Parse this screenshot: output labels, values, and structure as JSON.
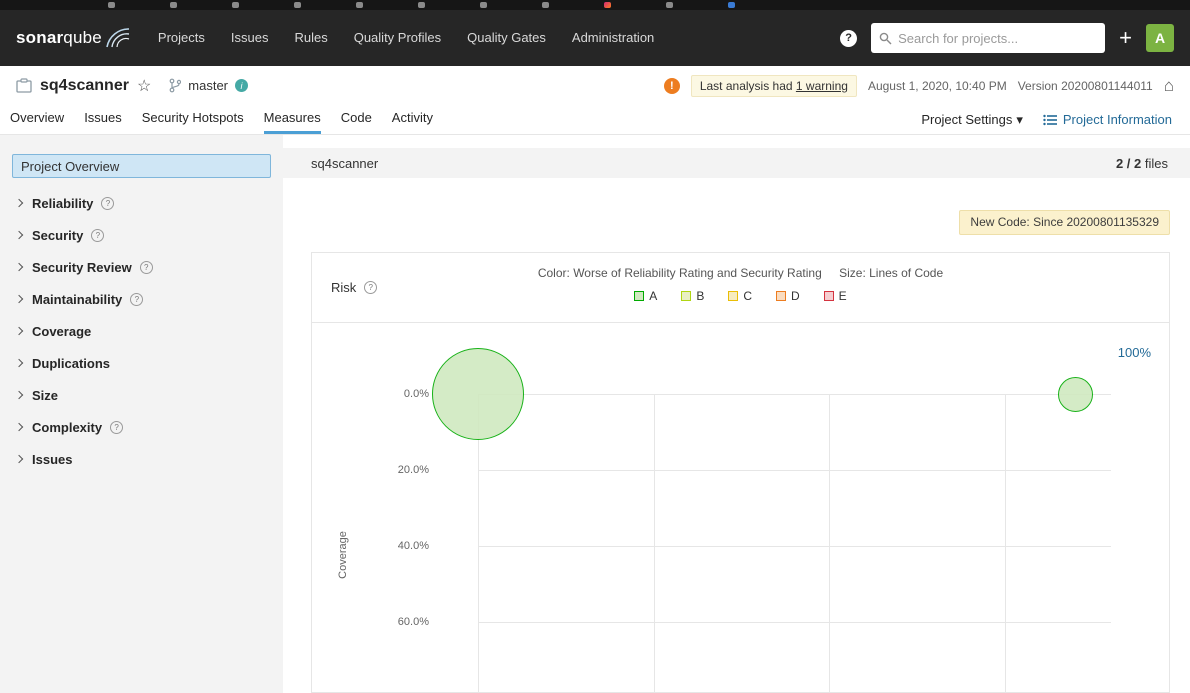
{
  "icons": {
    "help": "?",
    "plus": "+",
    "star": "☆",
    "home": "⌂",
    "caret_down": "▾",
    "warning": "!",
    "info": "i"
  },
  "navbar": {
    "logo_primary": "sonar",
    "logo_secondary": "qube",
    "items": [
      "Projects",
      "Issues",
      "Rules",
      "Quality Profiles",
      "Quality Gates",
      "Administration"
    ],
    "search_placeholder": "Search for projects...",
    "avatar_initial": "A"
  },
  "project_header": {
    "name": "sq4scanner",
    "branch": "master",
    "warning_prefix": "Last analysis had",
    "warning_link": "1 warning",
    "analysis_date": "August 1, 2020, 10:40 PM",
    "version": "Version 20200801144011"
  },
  "tabs": {
    "items": [
      "Overview",
      "Issues",
      "Security Hotspots",
      "Measures",
      "Code",
      "Activity"
    ],
    "active": "Measures",
    "project_settings": "Project Settings",
    "project_information": "Project Information"
  },
  "sidebar": {
    "selected": "Project Overview",
    "items": [
      {
        "label": "Reliability",
        "help": true
      },
      {
        "label": "Security",
        "help": true
      },
      {
        "label": "Security Review",
        "help": true
      },
      {
        "label": "Maintainability",
        "help": true
      },
      {
        "label": "Coverage",
        "help": false
      },
      {
        "label": "Duplications",
        "help": false
      },
      {
        "label": "Size",
        "help": false
      },
      {
        "label": "Complexity",
        "help": true
      },
      {
        "label": "Issues",
        "help": false
      }
    ]
  },
  "main": {
    "breadcrumb": "sq4scanner",
    "files_count": "2 / 2",
    "files_label": "files",
    "new_code_badge": "New Code: Since 20200801135329"
  },
  "chart_data": {
    "type": "bubble",
    "title": "Risk",
    "legend_color": "Color: Worse of Reliability Rating and Security Rating",
    "legend_size": "Size: Lines of Code",
    "ratings": [
      {
        "label": "A",
        "border": "#00aa00",
        "fill": "#d0e9c0"
      },
      {
        "label": "B",
        "border": "#b0d513",
        "fill": "#e9f0c3"
      },
      {
        "label": "C",
        "border": "#eabe06",
        "fill": "#f7ecc0"
      },
      {
        "label": "D",
        "border": "#ed7d20",
        "fill": "#fadcc0"
      },
      {
        "label": "E",
        "border": "#d4333f",
        "fill": "#f6cdd0"
      }
    ],
    "ylabel": "Coverage",
    "y_ticks": [
      "0.0%",
      "20.0%",
      "40.0%",
      "60.0%"
    ],
    "y_axis_inverted": true,
    "top_right_label": "100%",
    "points": [
      {
        "coverage_pct": 0.0,
        "rating": "A",
        "size": "large"
      },
      {
        "coverage_pct": 0.0,
        "rating": "A",
        "size": "small"
      }
    ]
  }
}
